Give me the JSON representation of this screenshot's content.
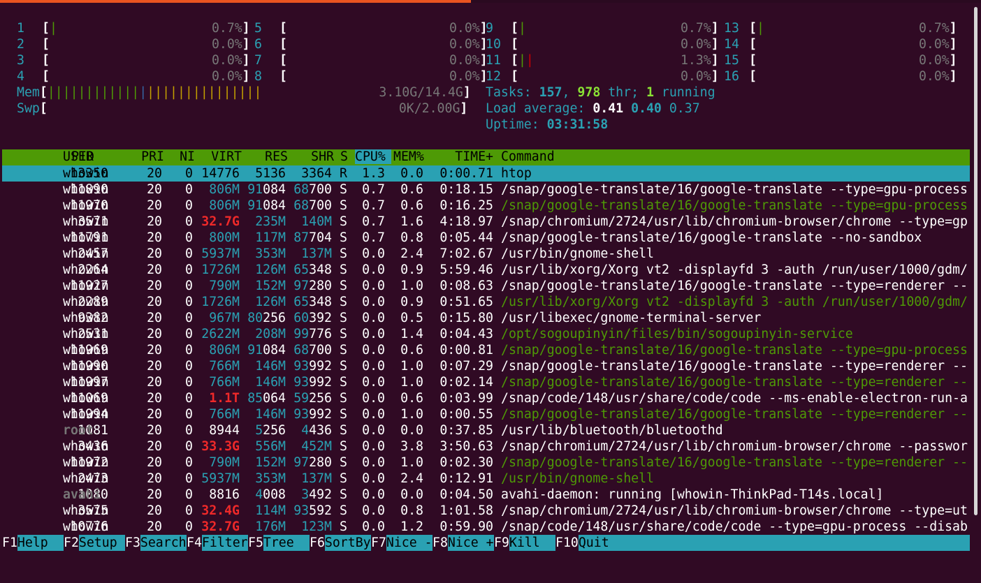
{
  "cpus": [
    {
      "id": "1",
      "bar": "|",
      "barColor": "green",
      "pct": "0.7%"
    },
    {
      "id": "2",
      "bar": "",
      "barColor": "",
      "pct": "0.0%"
    },
    {
      "id": "3",
      "bar": "",
      "barColor": "",
      "pct": "0.0%"
    },
    {
      "id": "4",
      "bar": "",
      "barColor": "",
      "pct": "0.0%"
    },
    {
      "id": "5",
      "bar": "",
      "barColor": "",
      "pct": "0.0%"
    },
    {
      "id": "6",
      "bar": "",
      "barColor": "",
      "pct": "0.0%"
    },
    {
      "id": "7",
      "bar": "",
      "barColor": "",
      "pct": "0.0%"
    },
    {
      "id": "8",
      "bar": "",
      "barColor": "",
      "pct": "0.0%"
    },
    {
      "id": "9",
      "bar": "|",
      "barColor": "green",
      "pct": "0.7%"
    },
    {
      "id": "10",
      "bar": "",
      "barColor": "",
      "pct": "0.0%"
    },
    {
      "id": "11",
      "bar": "||",
      "barColor": "mixed",
      "pct": "1.3%"
    },
    {
      "id": "12",
      "bar": "",
      "barColor": "",
      "pct": "0.0%"
    },
    {
      "id": "13",
      "bar": "|",
      "barColor": "green",
      "pct": "0.7%"
    },
    {
      "id": "14",
      "bar": "",
      "barColor": "",
      "pct": "0.0%"
    },
    {
      "id": "15",
      "bar": "",
      "barColor": "",
      "pct": "0.0%"
    },
    {
      "id": "16",
      "bar": "",
      "barColor": "",
      "pct": "0.0%"
    }
  ],
  "mem": {
    "label": "Mem",
    "value": "3.10G/14.4G"
  },
  "swp": {
    "label": "Swp",
    "value": "0K/2.00G"
  },
  "tasks": {
    "label": "Tasks: ",
    "count": "157",
    "sep": ", ",
    "thr": "978",
    "thr_label": " thr; ",
    "running": "1",
    "running_label": " running"
  },
  "load": {
    "label": "Load average: ",
    "l1": "0.41",
    "l5": "0.40",
    "l15": "0.37"
  },
  "uptime": {
    "label": "Uptime: ",
    "value": "03:31:58"
  },
  "header": {
    "pid": "PID",
    "user": "USER",
    "pri": "PRI",
    "ni": "NI",
    "virt": "VIRT",
    "res": "RES",
    "shr": "SHR",
    "s": "S",
    "cpu": "CPU%",
    "mem": "MEM%",
    "time": "TIME+",
    "command": "Command"
  },
  "processes": [
    {
      "pid": "13350",
      "user": "whowin",
      "pri": "20",
      "ni": "0",
      "virt": "14776",
      "res": "5136",
      "shr": "3364",
      "s": "R",
      "cpu": "1.3",
      "mem": "0.0",
      "time": "0:00.71",
      "command": "htop",
      "selected": true
    },
    {
      "pid": "11890",
      "user": "whowin",
      "pri": "20",
      "ni": "0",
      "virt": "806M",
      "res": "91084",
      "shr": "68700",
      "s": "S",
      "cpu": "0.7",
      "mem": "0.6",
      "time": "0:18.15",
      "command": "/snap/google-translate/16/google-translate --type=gpu-process"
    },
    {
      "pid": "11970",
      "user": "whowin",
      "pri": "20",
      "ni": "0",
      "virt": "806M",
      "res": "91084",
      "shr": "68700",
      "s": "S",
      "cpu": "0.7",
      "mem": "0.6",
      "time": "0:16.25",
      "command": "/snap/google-translate/16/google-translate --type=gpu-process",
      "thread": true
    },
    {
      "pid": "3571",
      "user": "whowin",
      "pri": "20",
      "ni": "0",
      "virt": "32.7G",
      "res": "235M",
      "shr": "140M",
      "s": "S",
      "cpu": "0.7",
      "mem": "1.6",
      "time": "4:18.97",
      "command": "/snap/chromium/2724/usr/lib/chromium-browser/chrome --type=gp"
    },
    {
      "pid": "11791",
      "user": "whowin",
      "pri": "20",
      "ni": "0",
      "virt": "800M",
      "res": "117M",
      "shr": "87704",
      "s": "S",
      "cpu": "0.7",
      "mem": "0.8",
      "time": "0:05.44",
      "command": "/snap/google-translate/16/google-translate --no-sandbox"
    },
    {
      "pid": "2457",
      "user": "whowin",
      "pri": "20",
      "ni": "0",
      "virt": "5937M",
      "res": "353M",
      "shr": "137M",
      "s": "S",
      "cpu": "0.0",
      "mem": "2.4",
      "time": "7:02.67",
      "command": "/usr/bin/gnome-shell"
    },
    {
      "pid": "2264",
      "user": "whowin",
      "pri": "20",
      "ni": "0",
      "virt": "1726M",
      "res": "126M",
      "shr": "65348",
      "s": "S",
      "cpu": "0.0",
      "mem": "0.9",
      "time": "5:59.46",
      "command": "/usr/lib/xorg/Xorg vt2 -displayfd 3 -auth /run/user/1000/gdm/"
    },
    {
      "pid": "11927",
      "user": "whowin",
      "pri": "20",
      "ni": "0",
      "virt": "790M",
      "res": "152M",
      "shr": "97280",
      "s": "S",
      "cpu": "0.0",
      "mem": "1.0",
      "time": "0:08.63",
      "command": "/snap/google-translate/16/google-translate --type=renderer --"
    },
    {
      "pid": "2289",
      "user": "whowin",
      "pri": "20",
      "ni": "0",
      "virt": "1726M",
      "res": "126M",
      "shr": "65348",
      "s": "S",
      "cpu": "0.0",
      "mem": "0.9",
      "time": "0:51.65",
      "command": "/usr/lib/xorg/Xorg vt2 -displayfd 3 -auth /run/user/1000/gdm/",
      "thread": true
    },
    {
      "pid": "9382",
      "user": "whowin",
      "pri": "20",
      "ni": "0",
      "virt": "967M",
      "res": "80256",
      "shr": "60392",
      "s": "S",
      "cpu": "0.0",
      "mem": "0.5",
      "time": "0:15.80",
      "command": "/usr/libexec/gnome-terminal-server"
    },
    {
      "pid": "2531",
      "user": "whowin",
      "pri": "20",
      "ni": "0",
      "virt": "2622M",
      "res": "208M",
      "shr": "99776",
      "s": "S",
      "cpu": "0.0",
      "mem": "1.4",
      "time": "0:04.43",
      "command": "/opt/sogoupinyin/files/bin/sogoupinyin-service",
      "thread": true
    },
    {
      "pid": "11969",
      "user": "whowin",
      "pri": "20",
      "ni": "0",
      "virt": "806M",
      "res": "91084",
      "shr": "68700",
      "s": "S",
      "cpu": "0.0",
      "mem": "0.6",
      "time": "0:00.81",
      "command": "/snap/google-translate/16/google-translate --type=gpu-process",
      "thread": true
    },
    {
      "pid": "11990",
      "user": "whowin",
      "pri": "20",
      "ni": "0",
      "virt": "766M",
      "res": "146M",
      "shr": "93992",
      "s": "S",
      "cpu": "0.0",
      "mem": "1.0",
      "time": "0:07.29",
      "command": "/snap/google-translate/16/google-translate --type=renderer --"
    },
    {
      "pid": "11997",
      "user": "whowin",
      "pri": "20",
      "ni": "0",
      "virt": "766M",
      "res": "146M",
      "shr": "93992",
      "s": "S",
      "cpu": "0.0",
      "mem": "1.0",
      "time": "0:02.14",
      "command": "/snap/google-translate/16/google-translate --type=renderer --",
      "thread": true
    },
    {
      "pid": "11069",
      "user": "whowin",
      "pri": "20",
      "ni": "0",
      "virt": "1.1T",
      "res": "85064",
      "shr": "59256",
      "s": "S",
      "cpu": "0.0",
      "mem": "0.6",
      "time": "0:03.99",
      "command": "/snap/code/148/usr/share/code/code --ms-enable-electron-run-a"
    },
    {
      "pid": "11994",
      "user": "whowin",
      "pri": "20",
      "ni": "0",
      "virt": "766M",
      "res": "146M",
      "shr": "93992",
      "s": "S",
      "cpu": "0.0",
      "mem": "1.0",
      "time": "0:00.55",
      "command": "/snap/google-translate/16/google-translate --type=renderer --",
      "thread": true
    },
    {
      "pid": "1081",
      "user": "root",
      "pri": "20",
      "ni": "0",
      "virt": "8944",
      "res": "5256",
      "shr": "4436",
      "s": "S",
      "cpu": "0.0",
      "mem": "0.0",
      "time": "0:37.85",
      "command": "/usr/lib/bluetooth/bluetoothd"
    },
    {
      "pid": "3436",
      "user": "whowin",
      "pri": "20",
      "ni": "0",
      "virt": "33.3G",
      "res": "556M",
      "shr": "452M",
      "s": "S",
      "cpu": "0.0",
      "mem": "3.8",
      "time": "3:50.63",
      "command": "/snap/chromium/2724/usr/lib/chromium-browser/chrome --passwor"
    },
    {
      "pid": "11972",
      "user": "whowin",
      "pri": "20",
      "ni": "0",
      "virt": "790M",
      "res": "152M",
      "shr": "97280",
      "s": "S",
      "cpu": "0.0",
      "mem": "1.0",
      "time": "0:02.30",
      "command": "/snap/google-translate/16/google-translate --type=renderer --",
      "thread": true
    },
    {
      "pid": "2473",
      "user": "whowin",
      "pri": "20",
      "ni": "0",
      "virt": "5937M",
      "res": "353M",
      "shr": "137M",
      "s": "S",
      "cpu": "0.0",
      "mem": "2.4",
      "time": "0:12.91",
      "command": "/usr/bin/gnome-shell",
      "thread": true
    },
    {
      "pid": "1080",
      "user": "avahi",
      "pri": "20",
      "ni": "0",
      "virt": "8816",
      "res": "4008",
      "shr": "3492",
      "s": "S",
      "cpu": "0.0",
      "mem": "0.0",
      "time": "0:04.50",
      "command": "avahi-daemon: running [whowin-ThinkPad-T14s.local]"
    },
    {
      "pid": "3575",
      "user": "whowin",
      "pri": "20",
      "ni": "0",
      "virt": "32.4G",
      "res": "114M",
      "shr": "93592",
      "s": "S",
      "cpu": "0.0",
      "mem": "0.8",
      "time": "1:01.58",
      "command": "/snap/chromium/2724/usr/lib/chromium-browser/chrome --type=ut"
    },
    {
      "pid": "10776",
      "user": "whowin",
      "pri": "20",
      "ni": "0",
      "virt": "32.7G",
      "res": "176M",
      "shr": "123M",
      "s": "S",
      "cpu": "0.0",
      "mem": "1.2",
      "time": "0:59.90",
      "command": "/snap/code/148/usr/share/code/code --type=gpu-process --disab"
    }
  ],
  "fkeys": [
    {
      "key": "F1",
      "label": "Help  "
    },
    {
      "key": "F2",
      "label": "Setup "
    },
    {
      "key": "F3",
      "label": "Search"
    },
    {
      "key": "F4",
      "label": "Filter"
    },
    {
      "key": "F5",
      "label": "Tree  "
    },
    {
      "key": "F6",
      "label": "SortBy"
    },
    {
      "key": "F7",
      "label": "Nice -"
    },
    {
      "key": "F8",
      "label": "Nice +"
    },
    {
      "key": "F9",
      "label": "Kill  "
    },
    {
      "key": "F10",
      "label": "Quit"
    }
  ],
  "colors": {
    "background": "#300a24",
    "accent": "#2aa1b3",
    "header": "#4e9a06",
    "tab": "#e95420"
  }
}
